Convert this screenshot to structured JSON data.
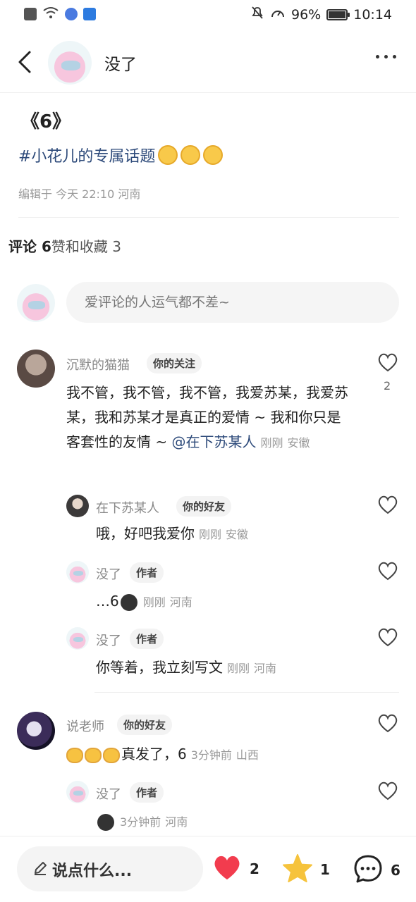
{
  "status_bar": {
    "battery": "96%",
    "time": "10:14"
  },
  "header": {
    "title": "没了"
  },
  "post": {
    "title": "《6》",
    "tag": "#小花儿的专属话题",
    "meta": "编辑于 今天 22:10 河南"
  },
  "stats": {
    "comments": "评论 6",
    "likes": "赞和收藏 3"
  },
  "comment_input": {
    "placeholder": "爱评论的人运气都不差~"
  },
  "comments": [
    {
      "name": "沉默的猫猫",
      "badge": "你的关注",
      "text": "我不管，我不管，我不管，我爱苏某，我爱苏某，我和苏某才是真正的爱情 ~ 我和你只是客套性的友情 ~ ",
      "mention": "@在下苏某人",
      "time": "刚刚",
      "location": "安徽",
      "likes": "2",
      "replies": [
        {
          "name": "在下苏某人",
          "badge": "你的好友",
          "text": "哦，好吧我爱你",
          "time": "刚刚",
          "location": "安徽"
        },
        {
          "name": "没了",
          "badge": "作者",
          "text": "…6",
          "time": "刚刚",
          "location": "河南"
        },
        {
          "name": "没了",
          "badge": "作者",
          "text": "你等着，我立刻写文",
          "time": "刚刚",
          "location": "河南"
        }
      ]
    },
    {
      "name": "说老师",
      "badge": "你的好友",
      "text": "真发了，6",
      "time": "3分钟前",
      "location": "山西",
      "replies": [
        {
          "name": "没了",
          "badge": "作者",
          "text": "",
          "time": "3分钟前",
          "location": "河南"
        }
      ]
    }
  ],
  "bottom_bar": {
    "input_label": "说点什么...",
    "like_count": "2",
    "collect_count": "1",
    "comment_count": "6"
  },
  "colors": {
    "like": "#f23c4e",
    "star": "#f6c33c",
    "link": "#2d4a7a"
  }
}
